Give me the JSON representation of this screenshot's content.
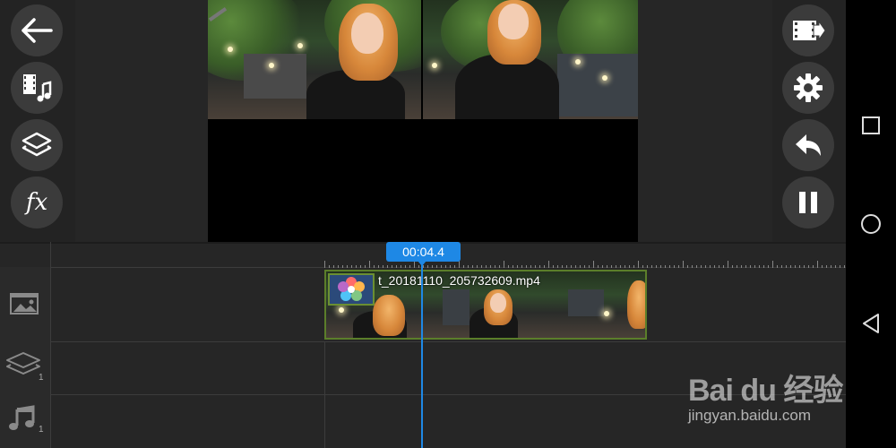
{
  "toolbar_left": {
    "back_icon": "arrow-left-icon",
    "media_icon": "film-music-icon",
    "layer_icon": "layers-icon",
    "fx_label": "fx"
  },
  "toolbar_right": {
    "export_icon": "film-export-icon",
    "settings_icon": "gear-icon",
    "undo_icon": "undo-icon",
    "pause_icon": "pause-icon"
  },
  "timeline": {
    "current_time": "00:04.4",
    "clip_filename": "t_20181110_205732609.mp4",
    "overlay_track_count": "1",
    "audio_track_count": "1"
  },
  "watermark": {
    "logo_text": "Bai du 经验",
    "url": "jingyan.baidu.com"
  },
  "colors": {
    "accent": "#1e88e5",
    "clip_border": "#5b7e2a",
    "button_bg": "#3b3b3b"
  }
}
